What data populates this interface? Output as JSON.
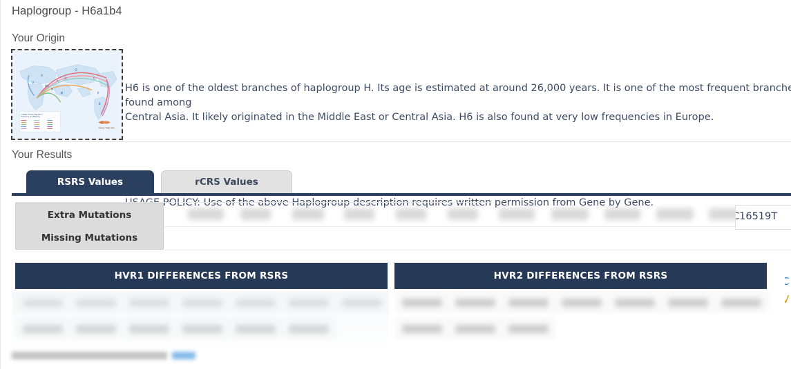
{
  "page": {
    "title": "Haplogroup - H6a1b4",
    "origin_heading": "Your Origin",
    "results_heading": "Your Results"
  },
  "origin": {
    "map_alt": "mtDNA human migration map",
    "map_caption": "mtDNA Human Migration Frequency and Mapping",
    "description_p1": "H6 is one of the oldest branches of haplogroup H. Its age is estimated at around 26,000 years. It is one of the most frequent branches of H found among\nCentral Asia. It likely originated in the Middle East or Central Asia. H6 is also found at very low frequencies in Europe.",
    "description_p2": "USAGE POLICY: Use of the above Haplogroup description requires written permission from Gene by Gene."
  },
  "tabs": [
    {
      "label": "RSRS Values",
      "active": true
    },
    {
      "label": "rCRS Values",
      "active": false
    }
  ],
  "mutations": {
    "extra_label": "Extra Mutations",
    "missing_label": "Missing Mutations",
    "extra_values": [
      "",
      "",
      "",
      "",
      "",
      "",
      "",
      "",
      "",
      "",
      ""
    ],
    "missing_values": [],
    "visible_value": "C16519T"
  },
  "hvr1": {
    "heading": "HVR1 DIFFERENCES FROM RSRS",
    "row1": [
      "",
      "",
      "",
      "",
      "",
      "",
      ""
    ],
    "row2": [
      "",
      "",
      "",
      "",
      "",
      ""
    ]
  },
  "hvr2": {
    "heading": "HVR2 DIFFERENCES FROM RSRS",
    "row1": [
      "",
      "",
      "",
      "",
      "",
      "",
      ""
    ],
    "row2": [
      "",
      "",
      ""
    ]
  },
  "footer": {
    "note": "",
    "link": ""
  },
  "colors": {
    "navy": "#2b3f5e",
    "panel_navy": "#263a58",
    "tab_idle": "#e2e2e2",
    "label_grey": "#dcdcdc",
    "text_blue": "#3c4a63",
    "link_blue": "#2e7fd1"
  }
}
